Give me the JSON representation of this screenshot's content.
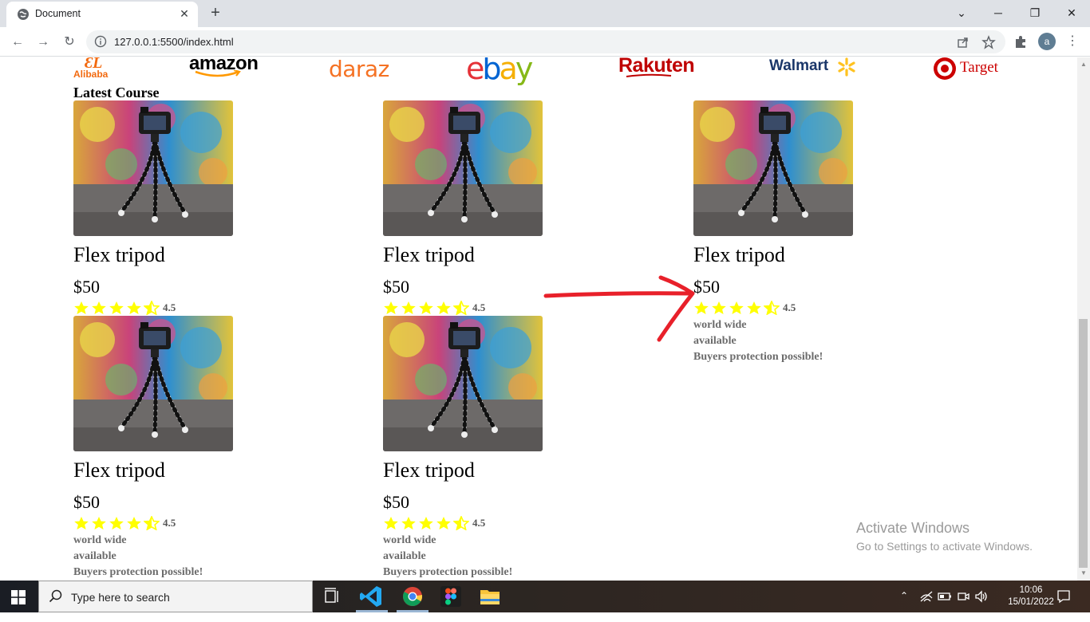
{
  "browser": {
    "tab_title": "Document",
    "url": "127.0.0.1:5500/index.html",
    "profile_initial": "a"
  },
  "brands": [
    "Alibaba",
    "amazon",
    "daraz",
    "ebay",
    "Rakuten",
    "Walmart",
    "Target"
  ],
  "section_title": "Latest Course",
  "products": [
    {
      "name": "Flex tripod",
      "price": "$50",
      "rating": "4.5",
      "stars": 4.5,
      "lines": []
    },
    {
      "name": "Flex tripod",
      "price": "$50",
      "rating": "4.5",
      "stars": 4.5,
      "lines": []
    },
    {
      "name": "Flex tripod",
      "price": "$50",
      "rating": "4.5",
      "stars": 4.5,
      "lines": [
        "world wide",
        "available",
        "Buyers protection possible!"
      ]
    },
    {
      "name": "Flex tripod",
      "price": "$50",
      "rating": "4.5",
      "stars": 4.5,
      "lines": [
        "world wide",
        "available",
        "Buyers protection possible!"
      ]
    },
    {
      "name": "Flex tripod",
      "price": "$50",
      "rating": "4.5",
      "stars": 4.5,
      "lines": [
        "world wide",
        "available",
        "Buyers protection possible!"
      ]
    }
  ],
  "watermark": {
    "title": "Activate Windows",
    "subtitle": "Go to Settings to activate Windows."
  },
  "taskbar": {
    "search_placeholder": "Type here to search",
    "time": "10:06",
    "date": "15/01/2022"
  },
  "colors": {
    "star": "#ffff00",
    "annotation_arrow": "#e8202a"
  }
}
